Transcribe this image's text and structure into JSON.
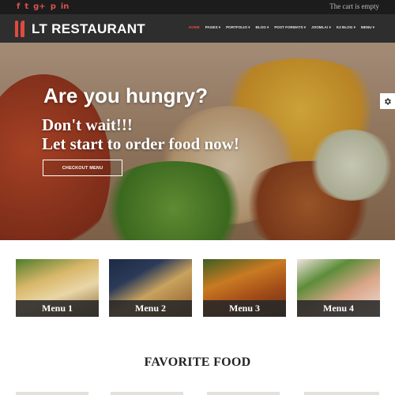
{
  "topbar": {
    "social_icons": [
      "facebook-icon",
      "twitter-icon",
      "google-plus-icon",
      "pinterest-icon",
      "linkedin-icon"
    ],
    "social_glyphs": [
      "f",
      "t",
      "g+",
      "p",
      "in"
    ],
    "cart_text": "The cart is empty"
  },
  "header": {
    "logo_text": "LT RESTAURANT",
    "nav": [
      "HOME",
      "PAGES ▾",
      "PORTFOLIO ▾",
      "BLOG ▾",
      "POST FORMATS ▾",
      "JOOMLA! ▾",
      "K2 BLOG ▾",
      "MENU ▾"
    ],
    "active_nav": 0
  },
  "hero": {
    "headline": "Are you hungry?",
    "line1": "Don't wait!!!",
    "line2": "Let start to order food now!",
    "cta_label": "CHECKOUT MENU"
  },
  "menus": [
    {
      "label": "Menu 1"
    },
    {
      "label": "Menu 2"
    },
    {
      "label": "Menu 3"
    },
    {
      "label": "Menu 4"
    }
  ],
  "section_title": "FAVORITE FOOD",
  "colors": {
    "accent": "#e04b3f",
    "topbar_bg": "#1c1c1c",
    "header_bg": "#2e2e2e",
    "card_strip": "#282828"
  }
}
